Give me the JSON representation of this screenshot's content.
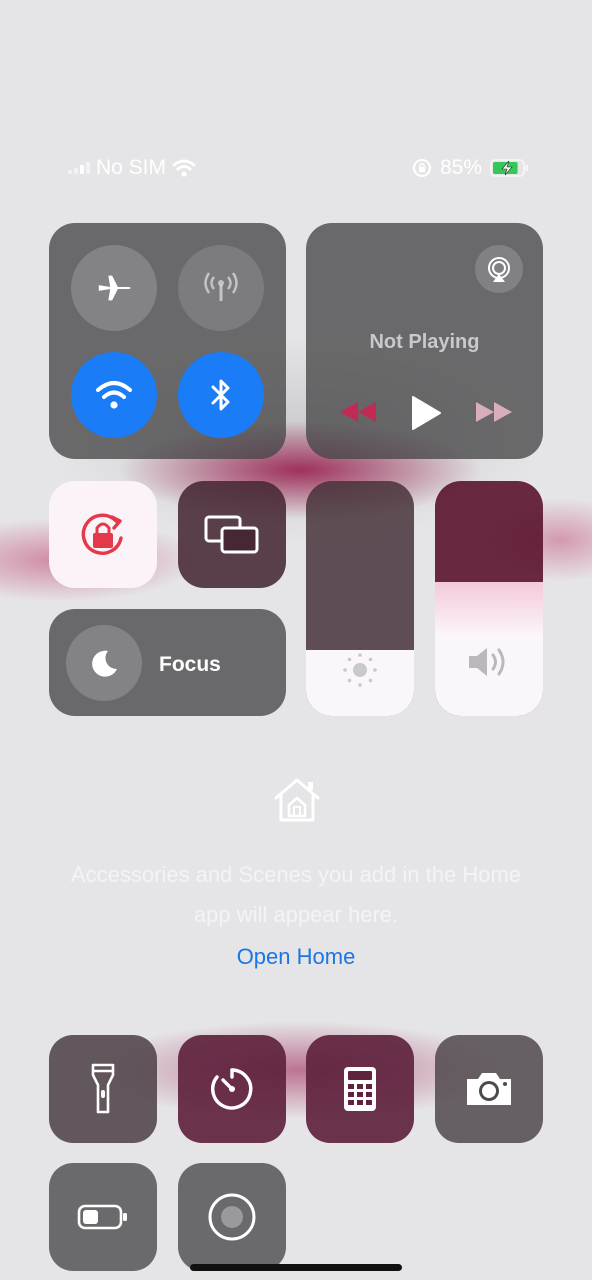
{
  "status_bar": {
    "carrier": "No SIM",
    "battery_percent": "85%",
    "battery_level": 0.85,
    "icons": [
      "signal-icon",
      "wifi-icon",
      "orientation-lock-icon",
      "battery-charging-icon"
    ]
  },
  "connectivity": {
    "airplane_mode": false,
    "cellular_data": false,
    "wifi": true,
    "bluetooth": true
  },
  "media": {
    "title": "Not Playing",
    "icons": [
      "airplay-icon",
      "rewind-icon",
      "play-icon",
      "fast-forward-icon"
    ]
  },
  "controls": {
    "orientation_lock": true,
    "screen_mirroring": false,
    "focus_label": "Focus",
    "brightness_level": 0.28,
    "volume_level": 0.57
  },
  "home": {
    "message": "Accessories and Scenes you add in the Home app will appear here.",
    "open_label": "Open Home"
  },
  "tools": [
    "flashlight-icon",
    "timer-icon",
    "calculator-icon",
    "camera-icon",
    "low-power-icon",
    "screen-record-icon"
  ],
  "colors": {
    "accent_blue": "#1a7cf6",
    "lock_red": "#e4394a",
    "link_blue": "#1a76e3"
  }
}
